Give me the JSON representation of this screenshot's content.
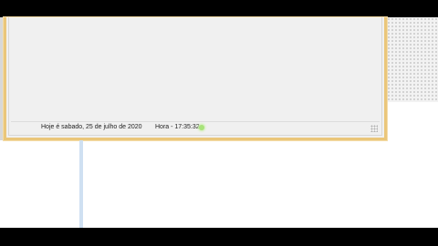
{
  "statusbar": {
    "date_text": "Hoje é sabado, 25 de julho de 2020",
    "time_text": "Hora - 17:35:32"
  },
  "colors": {
    "window_border": "#eac67a",
    "window_background": "#f0f0f0",
    "cursor_highlight": "#a7e37a",
    "connector_line": "#cfe0f2"
  }
}
